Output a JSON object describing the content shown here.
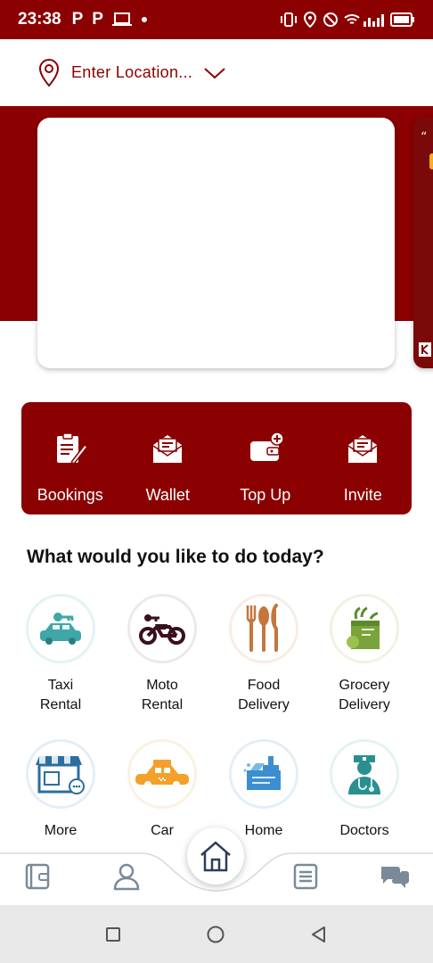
{
  "status_bar": {
    "time": "23:38",
    "left_icons": [
      "P",
      "P"
    ]
  },
  "location": {
    "placeholder": "Enter Location..."
  },
  "quick_actions": [
    {
      "label": "Bookings",
      "icon": "bookings-icon"
    },
    {
      "label": "Wallet",
      "icon": "wallet-envelope-icon"
    },
    {
      "label": "Top Up",
      "icon": "top-up-wallet-icon"
    },
    {
      "label": "Invite",
      "icon": "invite-envelope-icon"
    }
  ],
  "section_title": "What would you like to do today?",
  "services": [
    {
      "line1": "Taxi",
      "line2": "Rental",
      "icon": "taxi-car-icon"
    },
    {
      "line1": "Moto",
      "line2": "Rental",
      "icon": "motorbike-icon"
    },
    {
      "line1": "Food",
      "line2": "Delivery",
      "icon": "food-cutlery-icon"
    },
    {
      "line1": "Grocery",
      "line2": "Delivery",
      "icon": "grocery-bag-icon"
    },
    {
      "line1": "More",
      "line2": "",
      "icon": "store-icon"
    },
    {
      "line1": "Car",
      "line2": "",
      "icon": "yellow-taxi-icon"
    },
    {
      "line1": "Home",
      "line2": "",
      "icon": "home-cleaning-icon"
    },
    {
      "line1": "Doctors",
      "line2": "",
      "icon": "doctor-icon"
    }
  ],
  "bottom_nav": [
    "wallet-icon",
    "profile-icon",
    "home-icon",
    "orders-list-icon",
    "chat-icon"
  ],
  "colors": {
    "brand": "#8b0000",
    "nav_icon": "#7a8a99"
  }
}
